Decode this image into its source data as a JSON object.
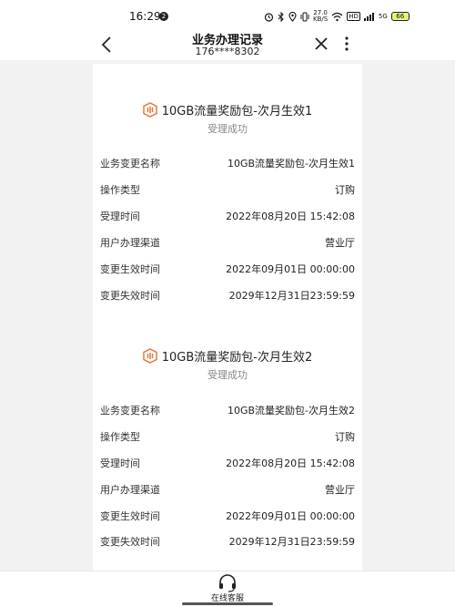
{
  "status_bar": {
    "time": "16:29",
    "notif_badge": "2",
    "net_speed": "27.0\nKB/S",
    "signal_1": "HD",
    "signal_2": "5G",
    "battery": "66"
  },
  "nav": {
    "title": "业务办理记录",
    "subtitle": "176****8302"
  },
  "records": [
    {
      "title": "10GB流量奖励包-次月生效1",
      "status": "受理成功",
      "rows": [
        {
          "label": "业务变更名称",
          "value": "10GB流量奖励包-次月生效1"
        },
        {
          "label": "操作类型",
          "value": "订购"
        },
        {
          "label": "受理时间",
          "value": "2022年08月20日 15:42:08"
        },
        {
          "label": "用户办理渠道",
          "value": "营业厅"
        },
        {
          "label": "变更生效时间",
          "value": "2022年09月01日 00:00:00"
        },
        {
          "label": "变更失效时间",
          "value": "2029年12月31日23:59:59"
        }
      ]
    },
    {
      "title": "10GB流量奖励包-次月生效2",
      "status": "受理成功",
      "rows": [
        {
          "label": "业务变更名称",
          "value": "10GB流量奖励包-次月生效2"
        },
        {
          "label": "操作类型",
          "value": "订购"
        },
        {
          "label": "受理时间",
          "value": "2022年08月20日 15:42:08"
        },
        {
          "label": "用户办理渠道",
          "value": "营业厅"
        },
        {
          "label": "变更生效时间",
          "value": "2022年09月01日 00:00:00"
        },
        {
          "label": "变更失效时间",
          "value": "2029年12月31日23:59:59"
        }
      ]
    }
  ],
  "bottom": {
    "service_label": "在线客服",
    "service_icon": "headset-icon"
  },
  "colors": {
    "accent": "#e8763a",
    "background": "#f2f2f2",
    "card": "#ffffff",
    "status_text": "#888888"
  }
}
